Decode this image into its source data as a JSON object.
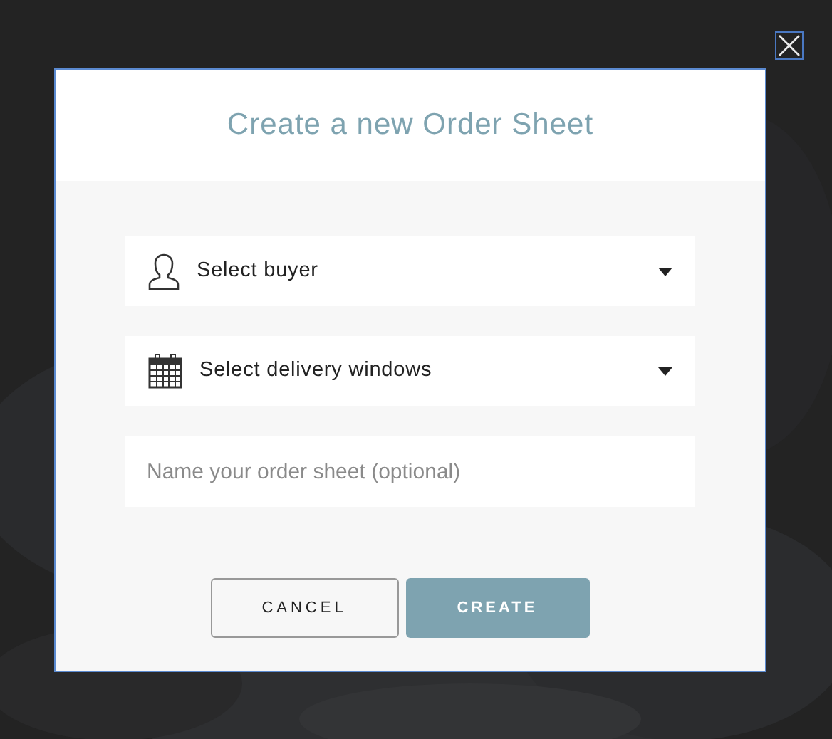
{
  "dialog": {
    "title": "Create a new Order Sheet",
    "fields": [
      {
        "kind": "select",
        "label": "Select buyer"
      },
      {
        "kind": "select",
        "label": "Select delivery windows"
      },
      {
        "kind": "text",
        "placeholder": "Name your order sheet (optional)"
      }
    ],
    "buttons": [
      {
        "kind": "secondary",
        "label": "CANCEL"
      },
      {
        "kind": "primary",
        "label": "CREATE"
      }
    ]
  }
}
